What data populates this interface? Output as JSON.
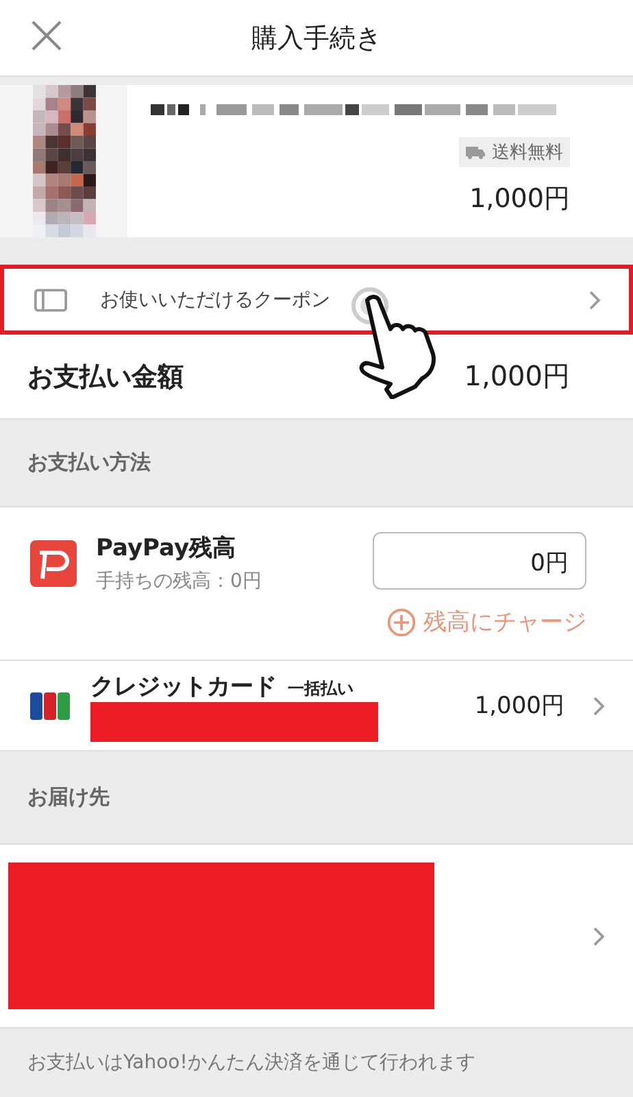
{
  "header": {
    "title": "購入手続き"
  },
  "item": {
    "badge": "送料無料",
    "price": "1,000円"
  },
  "coupon": {
    "label": "お使いいただけるクーポン",
    "highlighted": true
  },
  "total": {
    "label": "お支払い金額",
    "amount": "1,000円"
  },
  "payment": {
    "heading": "お支払い方法",
    "methods": [
      {
        "kind": "paypay",
        "name": "PayPay残高",
        "note": "手持ちの残高：0円",
        "value": "0円",
        "action": "残高にチャージ"
      },
      {
        "kind": "card",
        "name": "クレジットカード",
        "plan": "一括払い",
        "amount": "1,000円"
      }
    ]
  },
  "delivery": {
    "heading": "お届け先"
  },
  "footer": "お支払いはYahoo!かんたん決済を通じて行われます"
}
